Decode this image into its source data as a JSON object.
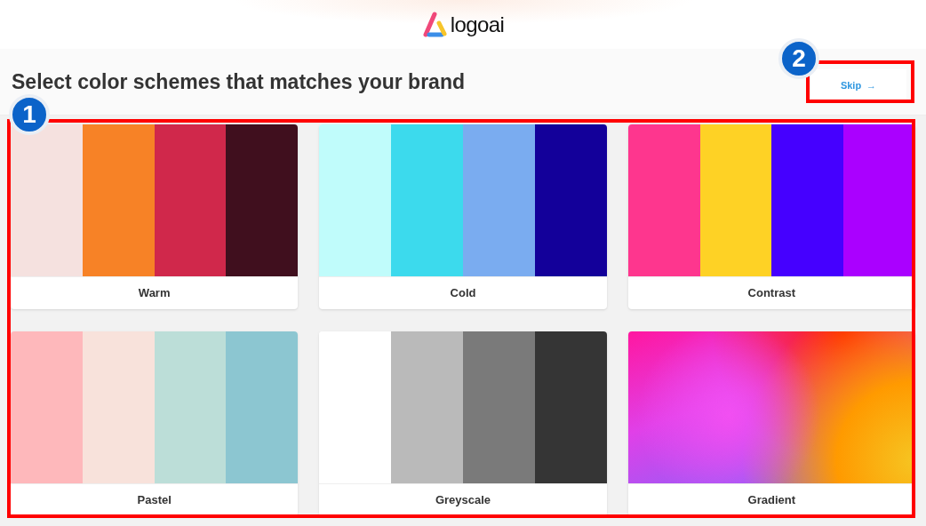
{
  "header": {
    "logo_text": "logoai"
  },
  "title": "Select color schemes that matches your brand",
  "skip_button": {
    "label": "Skip",
    "arrow": "→"
  },
  "annotations": [
    {
      "number": "1",
      "kind": "large"
    },
    {
      "number": "2",
      "kind": "small"
    }
  ],
  "schemes": [
    {
      "name": "Warm",
      "kind": "palette",
      "swatches": [
        {
          "color": "#f5e1df"
        },
        {
          "color": "#f78226"
        },
        {
          "color": "#d0284b"
        },
        {
          "color": "#400f1e"
        }
      ]
    },
    {
      "name": "Cold",
      "kind": "palette",
      "swatches": [
        {
          "color": "#c0fcfb"
        },
        {
          "color": "#3cdaed"
        },
        {
          "color": "#7aacf0"
        },
        {
          "color": "#13009a"
        }
      ]
    },
    {
      "name": "Contrast",
      "kind": "palette",
      "swatches": [
        {
          "color": "#fe368e"
        },
        {
          "color": "#fed225"
        },
        {
          "color": "#4500ff"
        },
        {
          "color": "#aa00ff"
        }
      ]
    },
    {
      "name": "Pastel",
      "kind": "palette",
      "swatches": [
        {
          "color": "#feb8bb"
        },
        {
          "color": "#f8e2db"
        },
        {
          "color": "#bcded8"
        },
        {
          "color": "#8cc6d1"
        }
      ]
    },
    {
      "name": "Greyscale",
      "kind": "palette",
      "swatches": [
        {
          "color": "#ffffff"
        },
        {
          "color": "#bababa"
        },
        {
          "color": "#7a7a7a"
        },
        {
          "color": "#353535"
        }
      ]
    },
    {
      "name": "Gradient",
      "kind": "gradient"
    }
  ]
}
